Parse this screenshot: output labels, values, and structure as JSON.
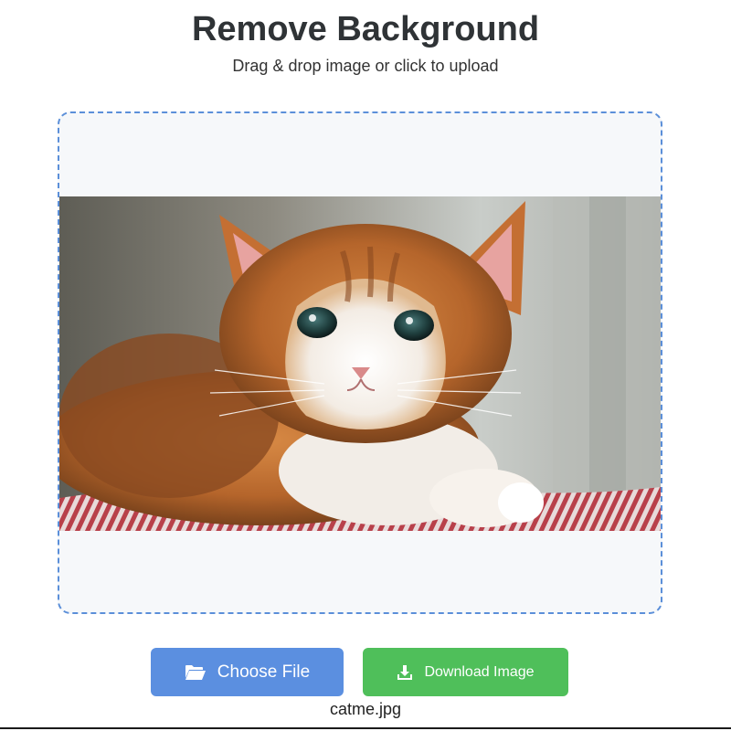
{
  "header": {
    "title": "Remove Background",
    "subtitle": "Drag & drop image or click to upload"
  },
  "dropzone": {
    "preview_alt": "Orange and white kitten lying on a red striped blanket"
  },
  "actions": {
    "choose_label": "Choose File",
    "choose_icon": "folder-open-icon",
    "download_label": "Download Image",
    "download_icon": "download-icon"
  },
  "file": {
    "name": "catme.jpg"
  },
  "colors": {
    "choose_button": "#5b8fe0",
    "download_button": "#4fbf5a",
    "dropzone_border": "#5b8fd9",
    "dropzone_bg": "#f6f8fa",
    "title_text": "#2f3336"
  }
}
